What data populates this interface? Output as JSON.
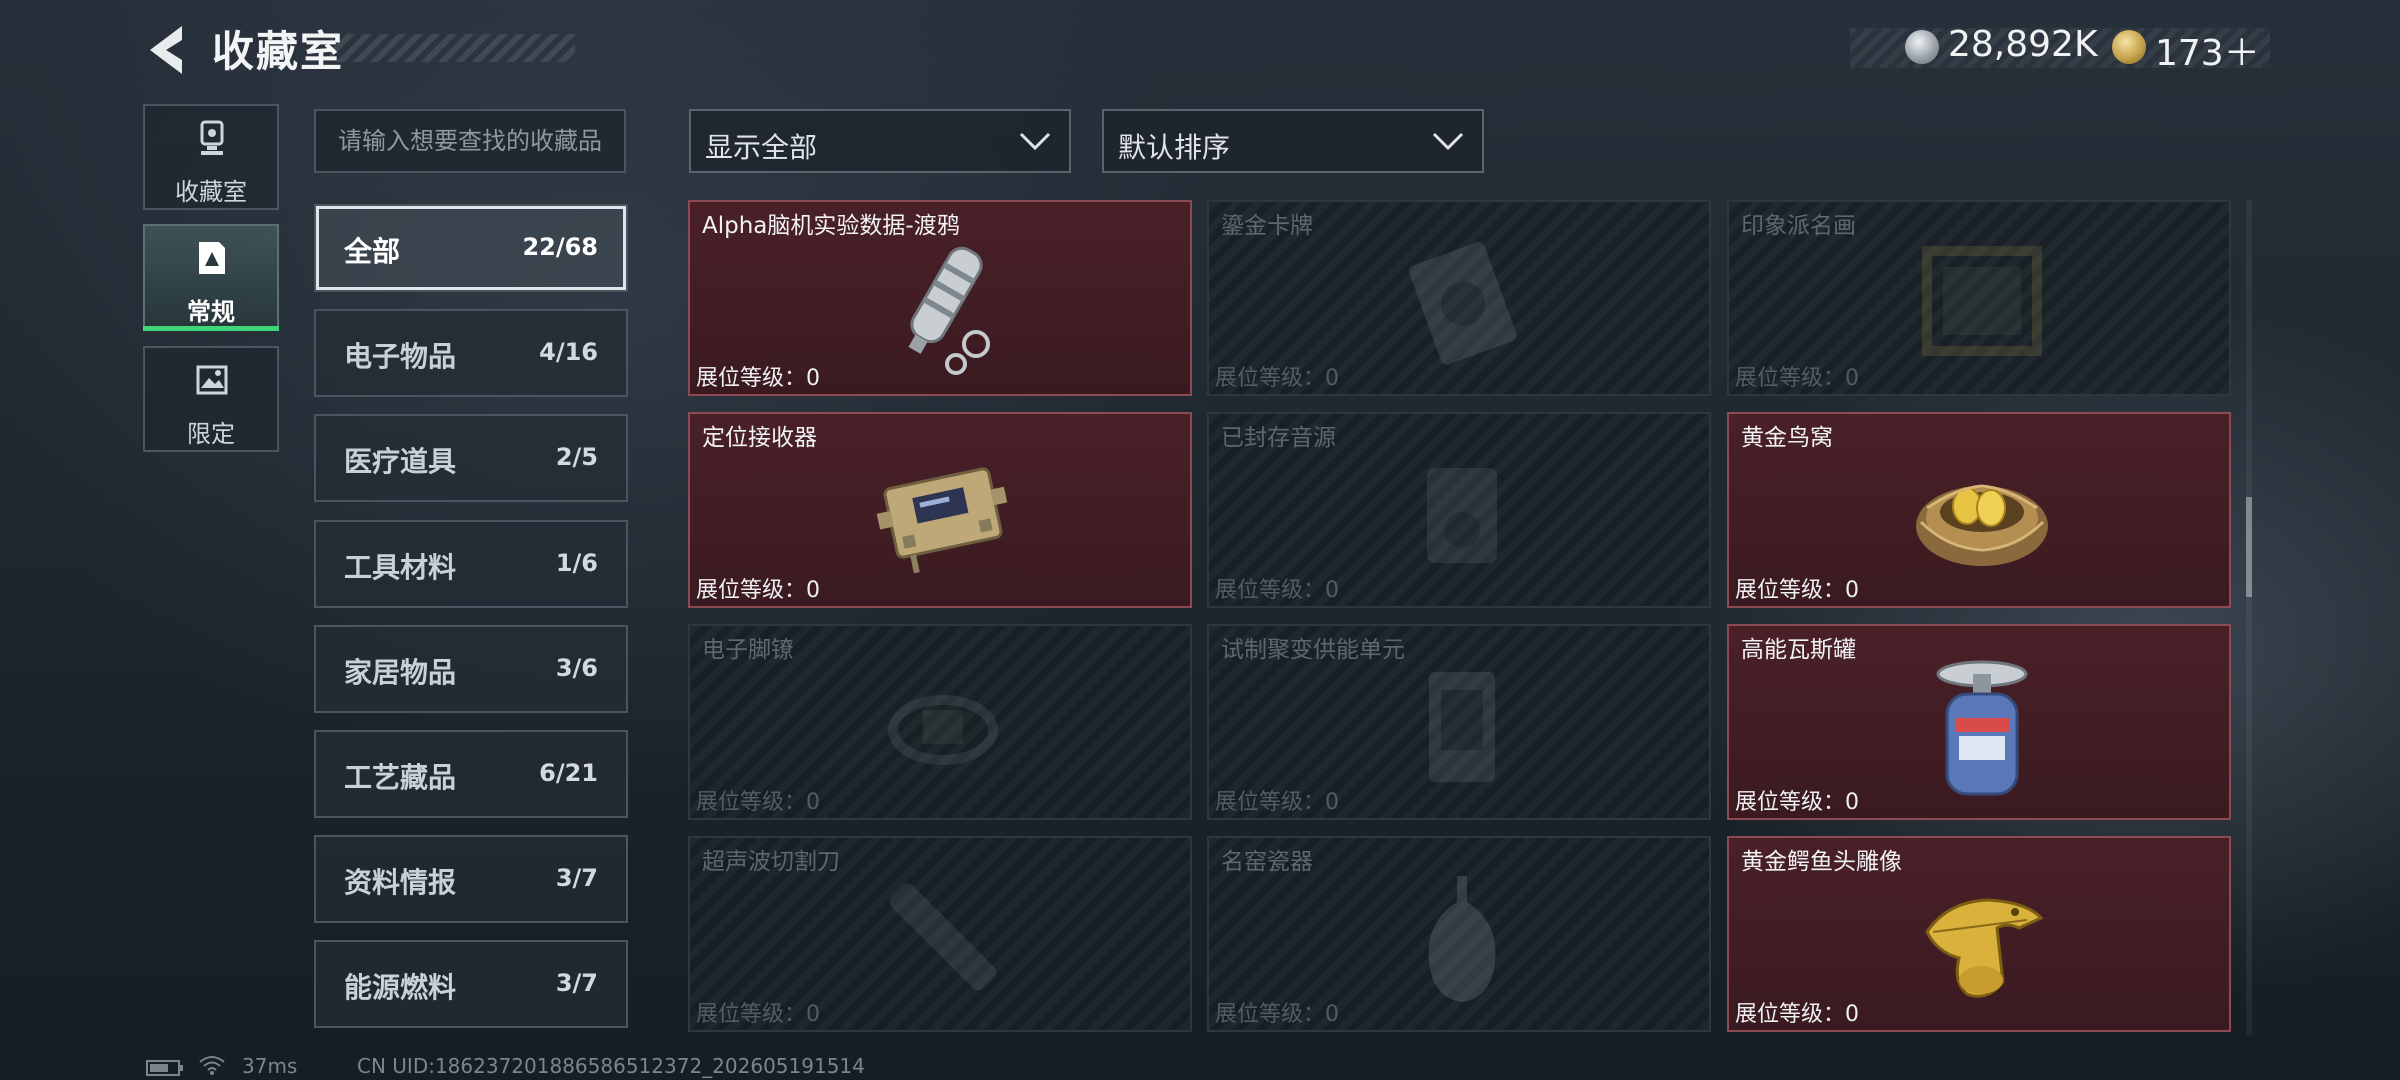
{
  "header": {
    "title": "收藏室",
    "currency": {
      "silver_value": "28,892K",
      "gold_value": "173＋"
    }
  },
  "nav": {
    "tabs": [
      {
        "label": "收藏室",
        "icon": "trophy-icon"
      },
      {
        "label": "常规",
        "icon": "document-icon"
      },
      {
        "label": "限定",
        "icon": "picture-icon"
      }
    ],
    "active_index": 1
  },
  "search": {
    "placeholder": "请输入想要查找的收藏品"
  },
  "categories": [
    {
      "label": "全部",
      "count": "22/68"
    },
    {
      "label": "电子物品",
      "count": "4/16"
    },
    {
      "label": "医疗道具",
      "count": "2/5"
    },
    {
      "label": "工具材料",
      "count": "1/6"
    },
    {
      "label": "家居物品",
      "count": "3/6"
    },
    {
      "label": "工艺藏品",
      "count": "6/21"
    },
    {
      "label": "资料情报",
      "count": "3/7"
    },
    {
      "label": "能源燃料",
      "count": "3/7"
    }
  ],
  "filters": {
    "display": "显示全部",
    "sort": "默认排序"
  },
  "items": [
    {
      "name": "Alpha脑机实验数据-渡鸦",
      "level": "展位等级：0",
      "collected": true,
      "icon": "data-capsule-icon"
    },
    {
      "name": "鎏金卡牌",
      "level": "展位等级：0",
      "collected": false,
      "icon": "card-icon"
    },
    {
      "name": "印象派名画",
      "level": "展位等级：0",
      "collected": false,
      "icon": "painting-icon"
    },
    {
      "name": "定位接收器",
      "level": "展位等级：0",
      "collected": true,
      "icon": "receiver-icon"
    },
    {
      "name": "已封存音源",
      "level": "展位等级：0",
      "collected": false,
      "icon": "audio-source-icon"
    },
    {
      "name": "黄金鸟窝",
      "level": "展位等级：0",
      "collected": true,
      "icon": "golden-nest-icon"
    },
    {
      "name": "电子脚镣",
      "level": "展位等级：0",
      "collected": false,
      "icon": "ankle-monitor-icon"
    },
    {
      "name": "试制聚变供能单元",
      "level": "展位等级：0",
      "collected": false,
      "icon": "fusion-cell-icon"
    },
    {
      "name": "高能瓦斯罐",
      "level": "展位等级：0",
      "collected": true,
      "icon": "gas-canister-icon"
    },
    {
      "name": "超声波切割刀",
      "level": "展位等级：0",
      "collected": false,
      "icon": "ultrasonic-cutter-icon"
    },
    {
      "name": "名窑瓷器",
      "level": "展位等级：0",
      "collected": false,
      "icon": "porcelain-icon"
    },
    {
      "name": "黄金鳄鱼头雕像",
      "level": "展位等级：0",
      "collected": true,
      "icon": "gold-crocodile-icon"
    }
  ],
  "status": {
    "ping": "37ms",
    "uid": "CN UID:18623720188658651237​2_202605191514"
  }
}
